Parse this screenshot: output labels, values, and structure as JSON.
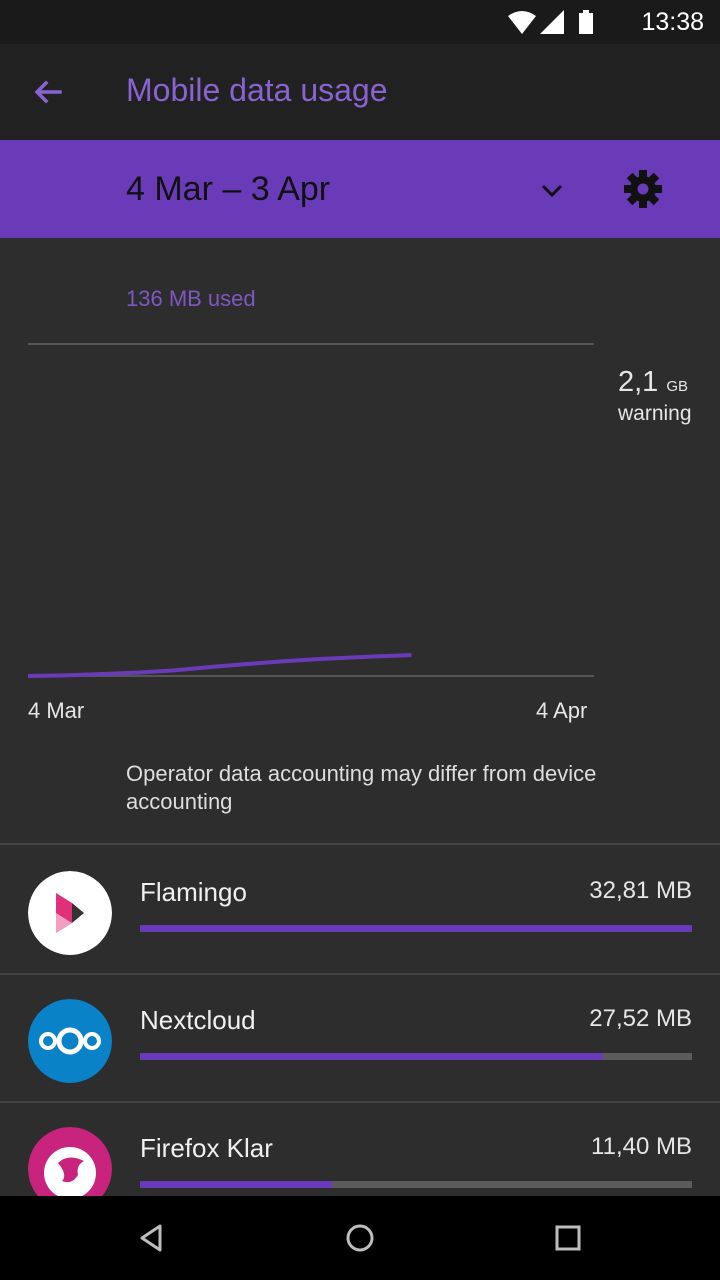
{
  "status_bar": {
    "time": "13:38",
    "icons": [
      "wifi-icon",
      "signal-icon",
      "battery-icon"
    ]
  },
  "header": {
    "title": "Mobile data usage",
    "back_icon": "arrow-back-icon"
  },
  "cycle": {
    "range": "4 Mar – 3 Apr",
    "dropdown_icon": "chevron-down-icon",
    "settings_icon": "gear-icon"
  },
  "usage": {
    "used": "136 MB used"
  },
  "chart_data": {
    "type": "line",
    "x_labels": [
      "4 Mar",
      "4 Apr"
    ],
    "warning_value": "2,1",
    "warning_unit": "GB",
    "warning_label": "warning",
    "series": [
      {
        "days": [
          0,
          2,
          4,
          6,
          8,
          10,
          12,
          14,
          16,
          18,
          21
        ],
        "mb": [
          0,
          4,
          12,
          22,
          36,
          58,
          78,
          96,
          110,
          122,
          136
        ]
      }
    ],
    "x_range_days": [
      0,
      31
    ],
    "y_max_mb": 2150,
    "colors": {
      "line": "#6a3bb8",
      "grid": "#555555"
    }
  },
  "disclaimer": "Operator data accounting may differ from device accounting",
  "apps": [
    {
      "name": "Flamingo",
      "size": "32,81 MB",
      "fraction": 1.0,
      "icon": "flamingo-icon"
    },
    {
      "name": "Nextcloud",
      "size": "27,52 MB",
      "fraction": 0.839,
      "icon": "nextcloud-icon"
    },
    {
      "name": "Firefox Klar",
      "size": "11,40 MB",
      "fraction": 0.347,
      "icon": "firefox-klar-icon"
    }
  ],
  "nav": {
    "back": "nav-back-icon",
    "home": "nav-home-icon",
    "recents": "nav-recents-icon"
  },
  "colors": {
    "accent": "#6a3bb8",
    "accent_text": "#8a63d2",
    "background": "#2d2d2d",
    "appbar": "#212121"
  }
}
